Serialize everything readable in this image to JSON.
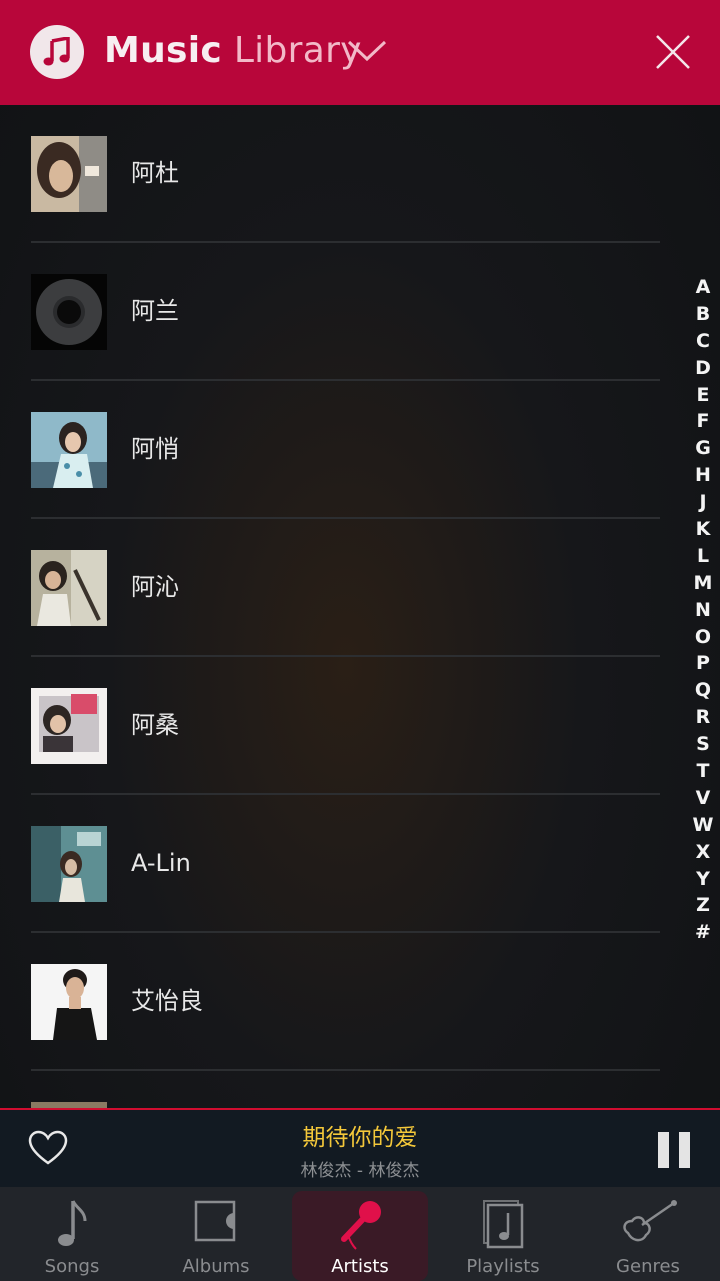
{
  "header": {
    "title_main": "Music",
    "title_sub": "Library"
  },
  "artists": [
    {
      "name": "阿杜"
    },
    {
      "name": "阿兰"
    },
    {
      "name": "阿悄"
    },
    {
      "name": "阿沁"
    },
    {
      "name": "阿桑"
    },
    {
      "name": "A-Lin"
    },
    {
      "name": "艾怡良"
    }
  ],
  "alphabet_index": [
    "A",
    "B",
    "C",
    "D",
    "E",
    "F",
    "G",
    "H",
    "J",
    "K",
    "L",
    "M",
    "N",
    "O",
    "P",
    "Q",
    "R",
    "S",
    "T",
    "V",
    "W",
    "X",
    "Y",
    "Z",
    "#"
  ],
  "now_playing": {
    "song": "期待你的爱",
    "artist_album": "林俊杰 - 林俊杰"
  },
  "tabs": [
    {
      "label": "Songs",
      "icon": "music-note-icon"
    },
    {
      "label": "Albums",
      "icon": "album-icon"
    },
    {
      "label": "Artists",
      "icon": "microphone-icon",
      "active": true
    },
    {
      "label": "Playlists",
      "icon": "playlist-icon"
    },
    {
      "label": "Genres",
      "icon": "violin-icon"
    }
  ],
  "colors": {
    "header": "#b8063a",
    "accent": "#e0104a",
    "song_title": "#f4c83a"
  }
}
